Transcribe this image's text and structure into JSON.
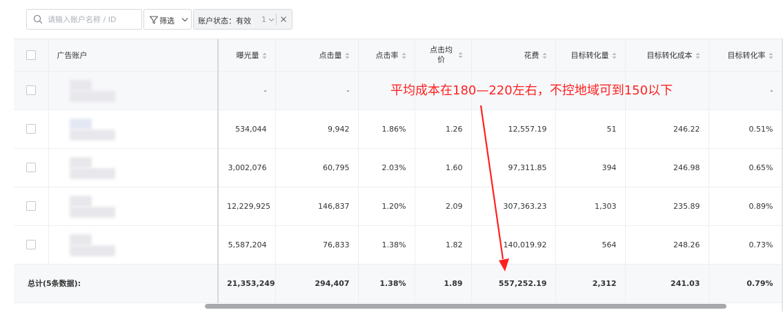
{
  "toolbar": {
    "search_placeholder": "请输入账户名称 / ID",
    "filter_label": "筛选",
    "tag_text": "账户状态：有效",
    "tag_count": "1"
  },
  "columns": {
    "account": "广告账户",
    "impressions": "曝光量",
    "clicks": "点击量",
    "ctr": "点击率",
    "cpc": "点击均价",
    "cost": "花费",
    "conversions": "目标转化量",
    "conv_cost": "目标转化成本",
    "conv_rate": "目标转化率"
  },
  "rows": [
    {
      "impressions": "-",
      "clicks": "-",
      "ctr": "",
      "cpc": "",
      "cost": "",
      "conversions": "",
      "conv_cost": "",
      "conv_rate": "-"
    },
    {
      "impressions": "534,044",
      "clicks": "9,942",
      "ctr": "1.86%",
      "cpc": "1.26",
      "cost": "12,557.19",
      "conversions": "51",
      "conv_cost": "246.22",
      "conv_rate": "0.51%"
    },
    {
      "impressions": "3,002,076",
      "clicks": "60,795",
      "ctr": "2.03%",
      "cpc": "1.60",
      "cost": "97,311.85",
      "conversions": "394",
      "conv_cost": "246.98",
      "conv_rate": "0.65%"
    },
    {
      "impressions": "12,229,925",
      "clicks": "146,837",
      "ctr": "1.20%",
      "cpc": "2.09",
      "cost": "307,363.23",
      "conversions": "1,303",
      "conv_cost": "235.89",
      "conv_rate": "0.89%"
    },
    {
      "impressions": "5,587,204",
      "clicks": "76,833",
      "ctr": "1.38%",
      "cpc": "1.82",
      "cost": "140,019.92",
      "conversions": "564",
      "conv_cost": "248.26",
      "conv_rate": "0.73%"
    }
  ],
  "totals": {
    "label": "总计(5条数据):",
    "impressions": "21,353,249",
    "clicks": "294,407",
    "ctr": "1.38%",
    "cpc": "1.89",
    "cost": "557,252.19",
    "conversions": "2,312",
    "conv_cost": "241.03",
    "conv_rate": "0.79%"
  },
  "annotation": {
    "text": "平均成本在180—220左右，不控地域可到150以下",
    "color": "#ff2020"
  },
  "icons": [
    "search-icon",
    "filter-icon",
    "chevron-down-icon",
    "close-icon",
    "sort-icon"
  ]
}
